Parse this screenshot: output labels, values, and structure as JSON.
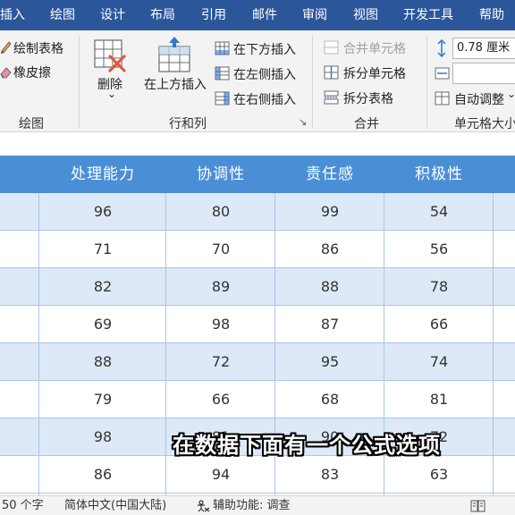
{
  "menu": {
    "tabs": [
      "插入",
      "绘图",
      "设计",
      "布局",
      "引用",
      "邮件",
      "审阅",
      "视图",
      "开发工具",
      "帮助"
    ]
  },
  "ribbon": {
    "draw": {
      "draw_table": "绘制表格",
      "eraser": "橡皮擦",
      "label": "绘图"
    },
    "rows_cols": {
      "delete": "删除",
      "delete_arrow": "⌄",
      "insert_above": "在上方插入",
      "insert_below": "在下方插入",
      "insert_left": "在左侧插入",
      "insert_right": "在右侧插入",
      "label": "行和列",
      "launcher": "↘"
    },
    "merge": {
      "merge_cells": "合并单元格",
      "split_cells": "拆分单元格",
      "split_table": "拆分表格",
      "label": "合并"
    },
    "cell_size": {
      "height_value": "0.78 厘米",
      "autofit": "自动调整",
      "autofit_arrow": "⌄",
      "label": "单元格大小"
    }
  },
  "table": {
    "headers": [
      "处理能力",
      "协调性",
      "责任感",
      "积极性"
    ],
    "rows": [
      [
        "96",
        "80",
        "99",
        "54"
      ],
      [
        "71",
        "70",
        "86",
        "56"
      ],
      [
        "82",
        "89",
        "88",
        "78"
      ],
      [
        "69",
        "98",
        "87",
        "66"
      ],
      [
        "88",
        "72",
        "95",
        "74"
      ],
      [
        "79",
        "66",
        "68",
        "81"
      ],
      [
        "98",
        "81",
        "90",
        "72"
      ],
      [
        "86",
        "94",
        "83",
        "63"
      ]
    ]
  },
  "subtitle": "在数据下面有一个公式选项",
  "status": {
    "word_count": "50 个字",
    "language": "简体中文(中国大陆)",
    "accessibility": "辅助功能: 调查"
  },
  "colors": {
    "menubar": "#2b579a",
    "table_header": "#4a8fd6",
    "row_alt": "#dde9f7"
  }
}
